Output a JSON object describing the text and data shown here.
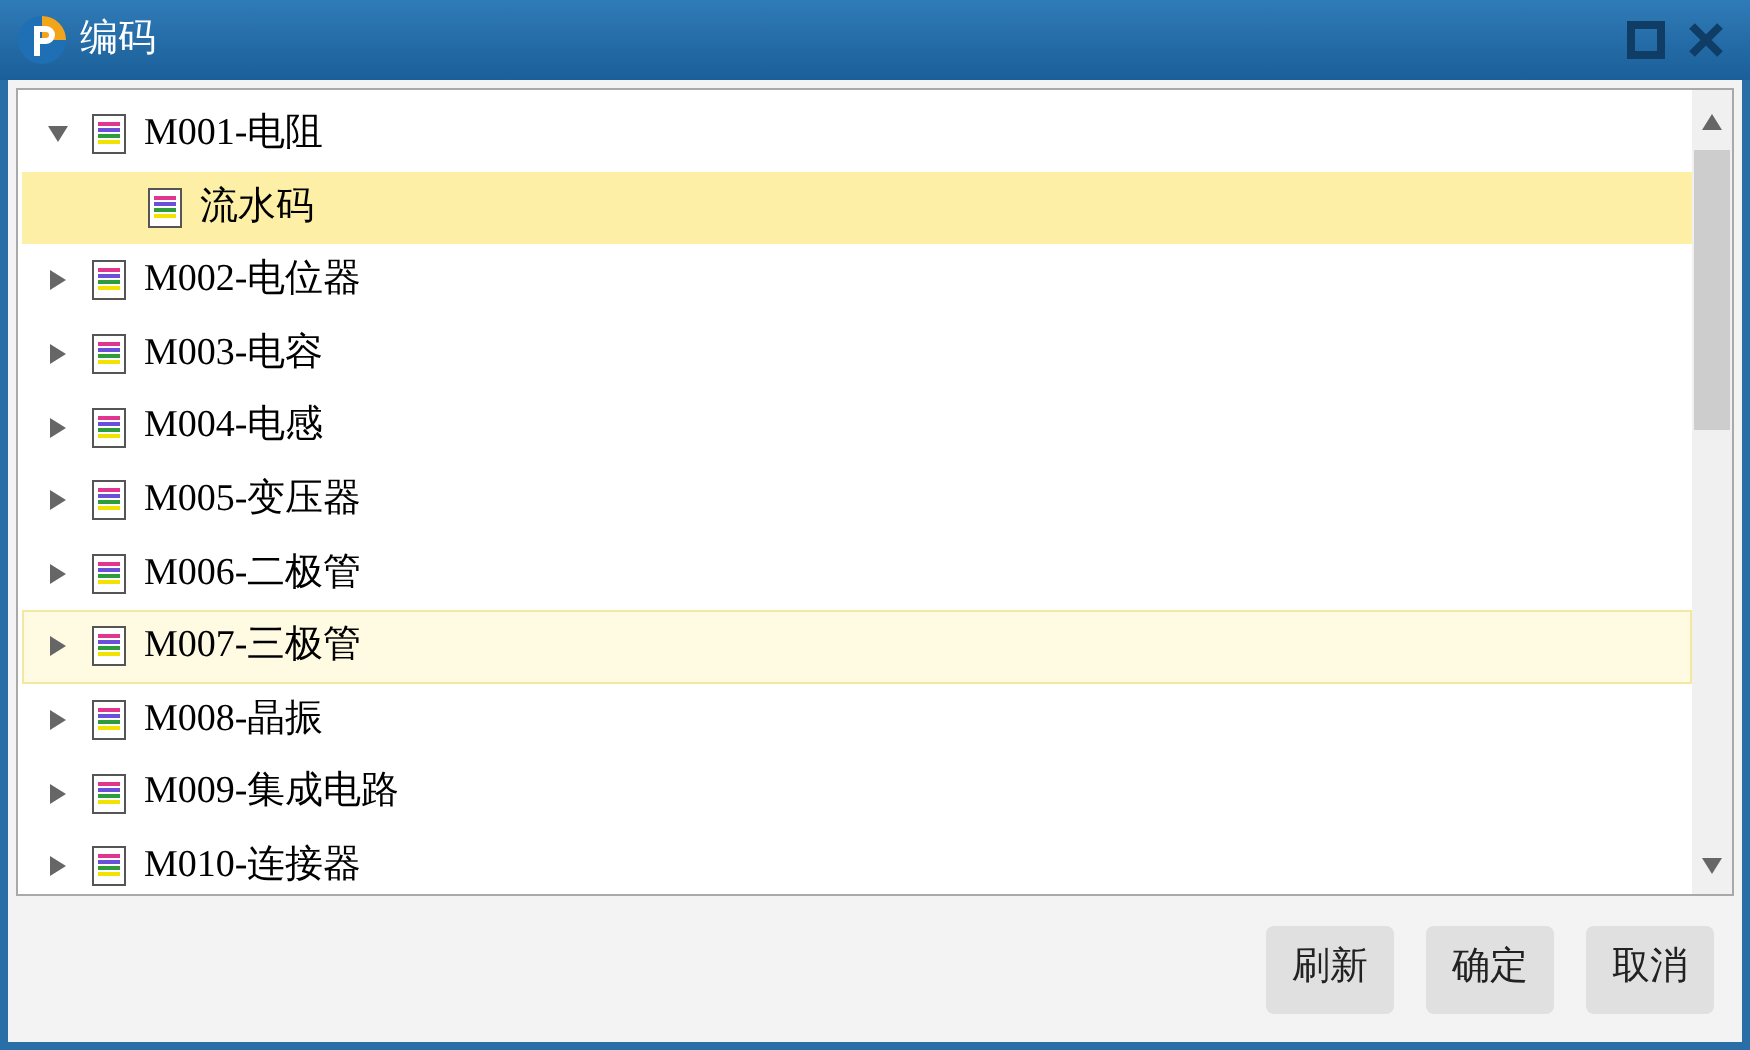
{
  "window": {
    "title": "编码"
  },
  "tree": [
    {
      "label": "M001-电阻",
      "expanded": true,
      "selected": false,
      "hovered": false,
      "children": [
        {
          "label": "流水码",
          "selected": true
        }
      ]
    },
    {
      "label": "M002-电位器",
      "expanded": false,
      "selected": false,
      "hovered": false
    },
    {
      "label": "M003-电容",
      "expanded": false,
      "selected": false,
      "hovered": false
    },
    {
      "label": "M004-电感",
      "expanded": false,
      "selected": false,
      "hovered": false
    },
    {
      "label": "M005-变压器",
      "expanded": false,
      "selected": false,
      "hovered": false
    },
    {
      "label": "M006-二极管",
      "expanded": false,
      "selected": false,
      "hovered": false
    },
    {
      "label": "M007-三极管",
      "expanded": false,
      "selected": false,
      "hovered": true
    },
    {
      "label": "M008-晶振",
      "expanded": false,
      "selected": false,
      "hovered": false
    },
    {
      "label": "M009-集成电路",
      "expanded": false,
      "selected": false,
      "hovered": false
    },
    {
      "label": "M010-连接器",
      "expanded": false,
      "selected": false,
      "hovered": false
    }
  ],
  "buttons": [
    "刷新",
    "确定",
    "取消"
  ]
}
